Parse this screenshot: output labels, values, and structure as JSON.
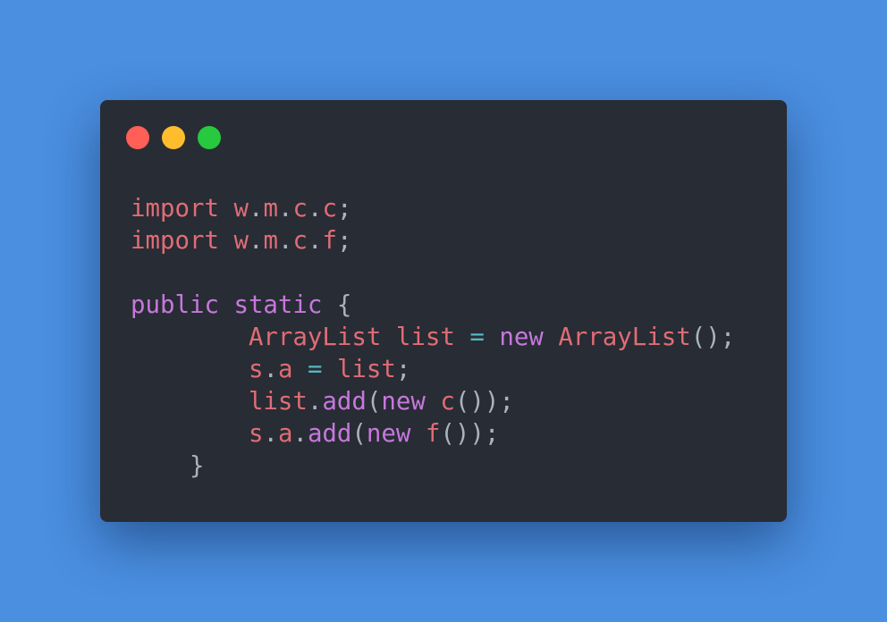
{
  "colors": {
    "background": "#4a8fe0",
    "window": "#282c34",
    "close": "#ff5f56",
    "minimize": "#ffbd2e",
    "maximize": "#27c93f",
    "keyword": "#c678dd",
    "identifier": "#e06c75",
    "operator": "#56b6c2",
    "punctuation": "#abb2bf"
  },
  "window_controls": {
    "close": "close-dot",
    "minimize": "minimize-dot",
    "maximize": "maximize-dot"
  },
  "code": {
    "lines": [
      [
        {
          "t": "import",
          "c": "identifier"
        },
        {
          "t": " ",
          "c": "punctuation"
        },
        {
          "t": "w",
          "c": "identifier"
        },
        {
          "t": ".",
          "c": "punctuation"
        },
        {
          "t": "m",
          "c": "identifier"
        },
        {
          "t": ".",
          "c": "punctuation"
        },
        {
          "t": "c",
          "c": "identifier"
        },
        {
          "t": ".",
          "c": "punctuation"
        },
        {
          "t": "c",
          "c": "identifier"
        },
        {
          "t": ";",
          "c": "punctuation"
        }
      ],
      [
        {
          "t": "import",
          "c": "identifier"
        },
        {
          "t": " ",
          "c": "punctuation"
        },
        {
          "t": "w",
          "c": "identifier"
        },
        {
          "t": ".",
          "c": "punctuation"
        },
        {
          "t": "m",
          "c": "identifier"
        },
        {
          "t": ".",
          "c": "punctuation"
        },
        {
          "t": "c",
          "c": "identifier"
        },
        {
          "t": ".",
          "c": "punctuation"
        },
        {
          "t": "f",
          "c": "identifier"
        },
        {
          "t": ";",
          "c": "punctuation"
        }
      ],
      [],
      [
        {
          "t": "public",
          "c": "keyword"
        },
        {
          "t": " ",
          "c": "punctuation"
        },
        {
          "t": "static",
          "c": "keyword"
        },
        {
          "t": " {",
          "c": "punctuation"
        }
      ],
      [
        {
          "t": "        ",
          "c": "punctuation"
        },
        {
          "t": "ArrayList",
          "c": "identifier"
        },
        {
          "t": " ",
          "c": "punctuation"
        },
        {
          "t": "list",
          "c": "identifier"
        },
        {
          "t": " ",
          "c": "punctuation"
        },
        {
          "t": "=",
          "c": "operator"
        },
        {
          "t": " ",
          "c": "punctuation"
        },
        {
          "t": "new",
          "c": "keyword"
        },
        {
          "t": " ",
          "c": "punctuation"
        },
        {
          "t": "ArrayList",
          "c": "identifier"
        },
        {
          "t": "();",
          "c": "punctuation"
        }
      ],
      [
        {
          "t": "        ",
          "c": "punctuation"
        },
        {
          "t": "s",
          "c": "identifier"
        },
        {
          "t": ".",
          "c": "punctuation"
        },
        {
          "t": "a",
          "c": "identifier"
        },
        {
          "t": " ",
          "c": "punctuation"
        },
        {
          "t": "=",
          "c": "operator"
        },
        {
          "t": " ",
          "c": "punctuation"
        },
        {
          "t": "list",
          "c": "identifier"
        },
        {
          "t": ";",
          "c": "punctuation"
        }
      ],
      [
        {
          "t": "        ",
          "c": "punctuation"
        },
        {
          "t": "list",
          "c": "identifier"
        },
        {
          "t": ".",
          "c": "punctuation"
        },
        {
          "t": "add",
          "c": "keyword"
        },
        {
          "t": "(",
          "c": "punctuation"
        },
        {
          "t": "new",
          "c": "keyword"
        },
        {
          "t": " ",
          "c": "punctuation"
        },
        {
          "t": "c",
          "c": "identifier"
        },
        {
          "t": "());",
          "c": "punctuation"
        }
      ],
      [
        {
          "t": "        ",
          "c": "punctuation"
        },
        {
          "t": "s",
          "c": "identifier"
        },
        {
          "t": ".",
          "c": "punctuation"
        },
        {
          "t": "a",
          "c": "identifier"
        },
        {
          "t": ".",
          "c": "punctuation"
        },
        {
          "t": "add",
          "c": "keyword"
        },
        {
          "t": "(",
          "c": "punctuation"
        },
        {
          "t": "new",
          "c": "keyword"
        },
        {
          "t": " ",
          "c": "punctuation"
        },
        {
          "t": "f",
          "c": "identifier"
        },
        {
          "t": "());",
          "c": "punctuation"
        }
      ],
      [
        {
          "t": "    }",
          "c": "punctuation"
        }
      ]
    ]
  }
}
